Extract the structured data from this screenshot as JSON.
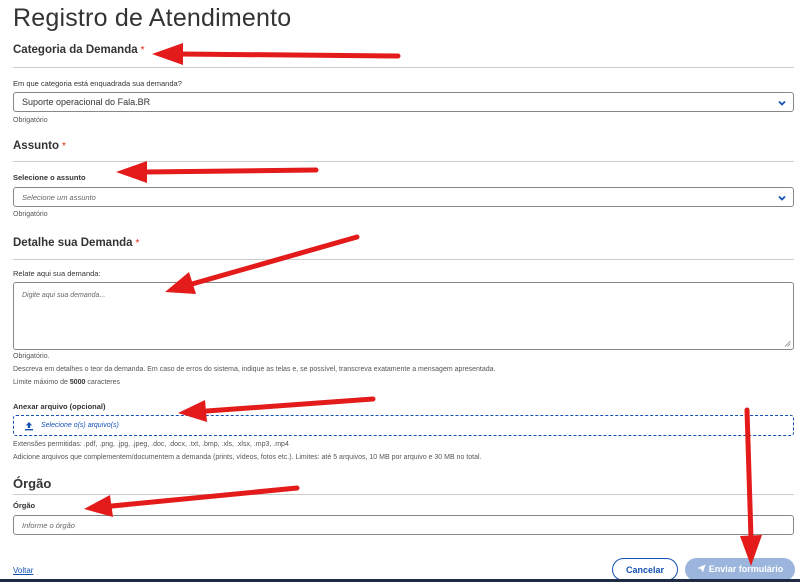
{
  "page": {
    "title": "Registro de Atendimento"
  },
  "required_mark": "*",
  "category": {
    "title": "Categoria da Demanda",
    "label": "Em que categoria está enquadrada sua demanda?",
    "value": "Suporte operacional do Fala.BR",
    "hint": "Obrigatório"
  },
  "subject": {
    "title": "Assunto",
    "label": "Selecione o assunto",
    "placeholder": "Selecione um assunto",
    "hint": "Obrigatório"
  },
  "detail": {
    "title": "Detalhe sua Demanda",
    "label": "Relate aqui sua demanda:",
    "placeholder": "Digite aqui sua demanda...",
    "hint_required": "Obrigatório.",
    "hint_description": "Descreva em detalhes o teor da demanda. Em caso de erros do sistema, indique as telas e, se possível, transcreva exatamente a mensagem apresentada.",
    "limit_prefix": "Limite máximo de",
    "limit_value": "5000",
    "limit_suffix": "caracteres"
  },
  "attachment": {
    "label": "Anexar arquivo (opcional)",
    "button": "Selecione o(s) arquivo(s)",
    "extensions": "Extensões permitidas: .pdf, .png, .jpg, .jpeg, .doc, .docx, .txt, .bmp, .xls, .xlsx, .mp3, .mp4",
    "limits": "Adicione arquivos que complementem/documentem a demanda (prints, vídeos, fotos etc.). Limites: até 5 arquivos, 10 MB por arquivo e 30 MB no total."
  },
  "organ": {
    "title": "Órgão",
    "label": "Órgão",
    "placeholder": "Informe o órgão"
  },
  "footer": {
    "back": "Voltar",
    "cancel": "Cancelar",
    "submit": "Enviar formulário"
  },
  "colors": {
    "primary": "#1351b4",
    "required": "#e52207",
    "submit_disabled": "#9bb5dd",
    "arrow": "#e31b1b"
  },
  "icons": {
    "select_chevron": "chevron-down-icon",
    "upload": "upload-icon",
    "submit": "paper-plane-icon",
    "resize": "resize-grip-icon"
  }
}
